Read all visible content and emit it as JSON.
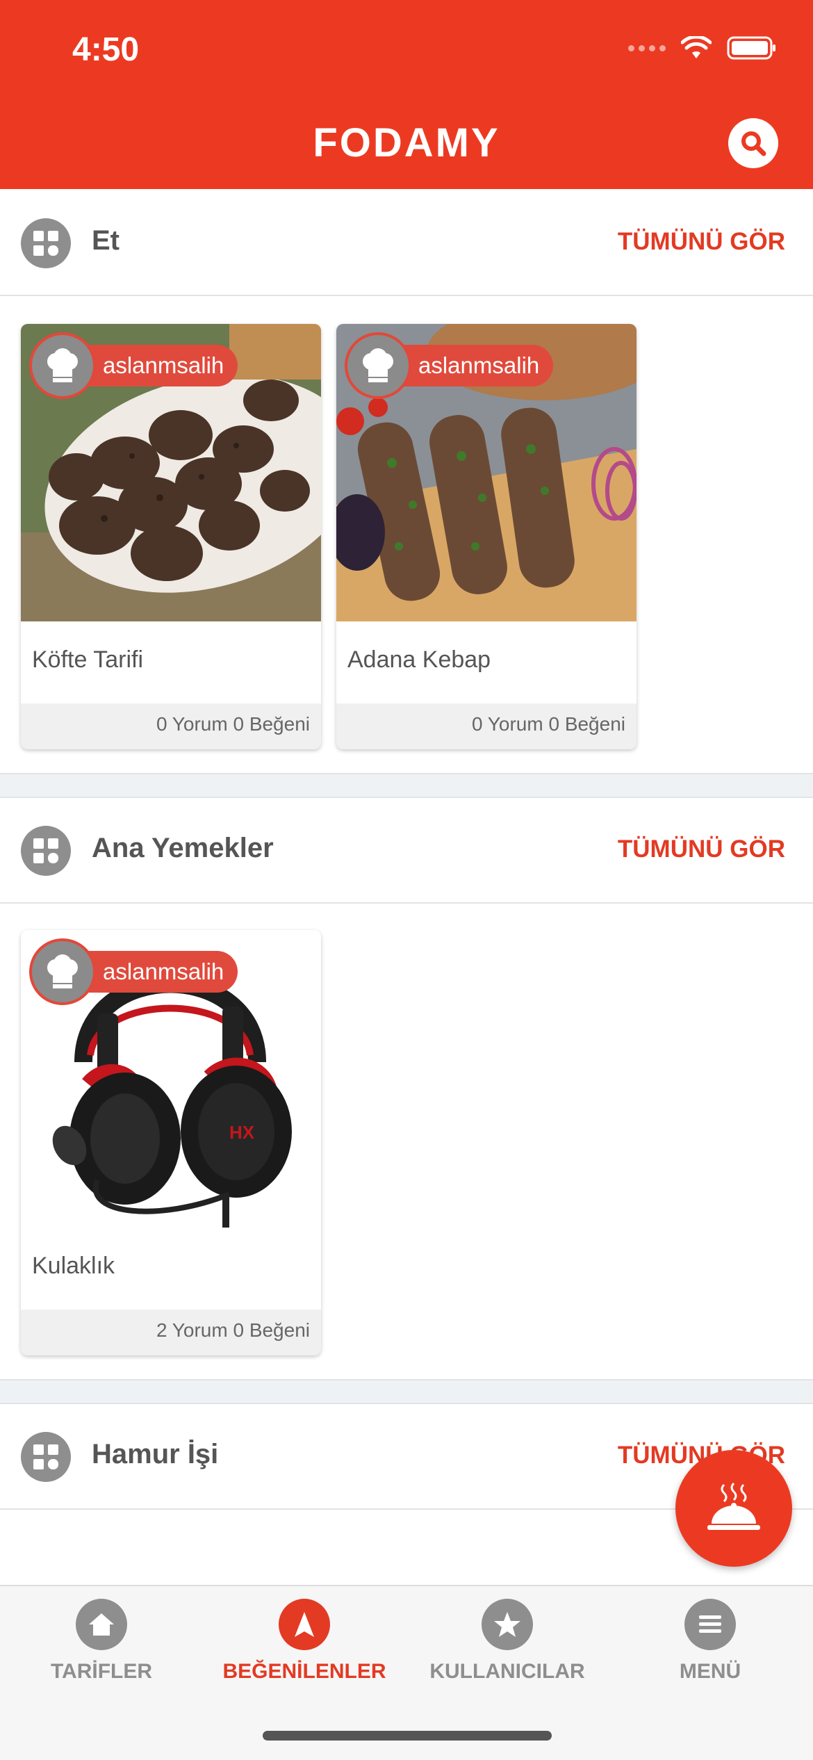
{
  "status_bar": {
    "time": "4:50"
  },
  "header": {
    "logo": "FODAMY"
  },
  "sections": [
    {
      "title": "Et",
      "see_all": "TÜMÜNÜ GÖR",
      "cards": [
        {
          "user": "aslanmsalih",
          "title": "Köfte Tarifi",
          "stats": "0 Yorum 0 Beğeni"
        },
        {
          "user": "aslanmsalih",
          "title": "Adana Kebap",
          "stats": "0 Yorum 0 Beğeni"
        }
      ]
    },
    {
      "title": "Ana Yemekler",
      "see_all": "TÜMÜNÜ GÖR",
      "cards": [
        {
          "user": "aslanmsalih",
          "title": "Kulaklık",
          "stats": "2 Yorum 0 Beğeni"
        }
      ]
    },
    {
      "title": "Hamur İşi",
      "see_all": "TÜMÜNÜ GÖR",
      "cards": []
    }
  ],
  "tabs": [
    {
      "label": "TARİFLER",
      "icon": "home-icon",
      "active": false
    },
    {
      "label": "BEĞENİLENLER",
      "icon": "compass-icon",
      "active": true
    },
    {
      "label": "KULLANICILAR",
      "icon": "star-icon",
      "active": false
    },
    {
      "label": "MENÜ",
      "icon": "menu-icon",
      "active": false
    }
  ],
  "colors": {
    "brand": "#ec3a22",
    "inactive": "#8e8e8e"
  }
}
